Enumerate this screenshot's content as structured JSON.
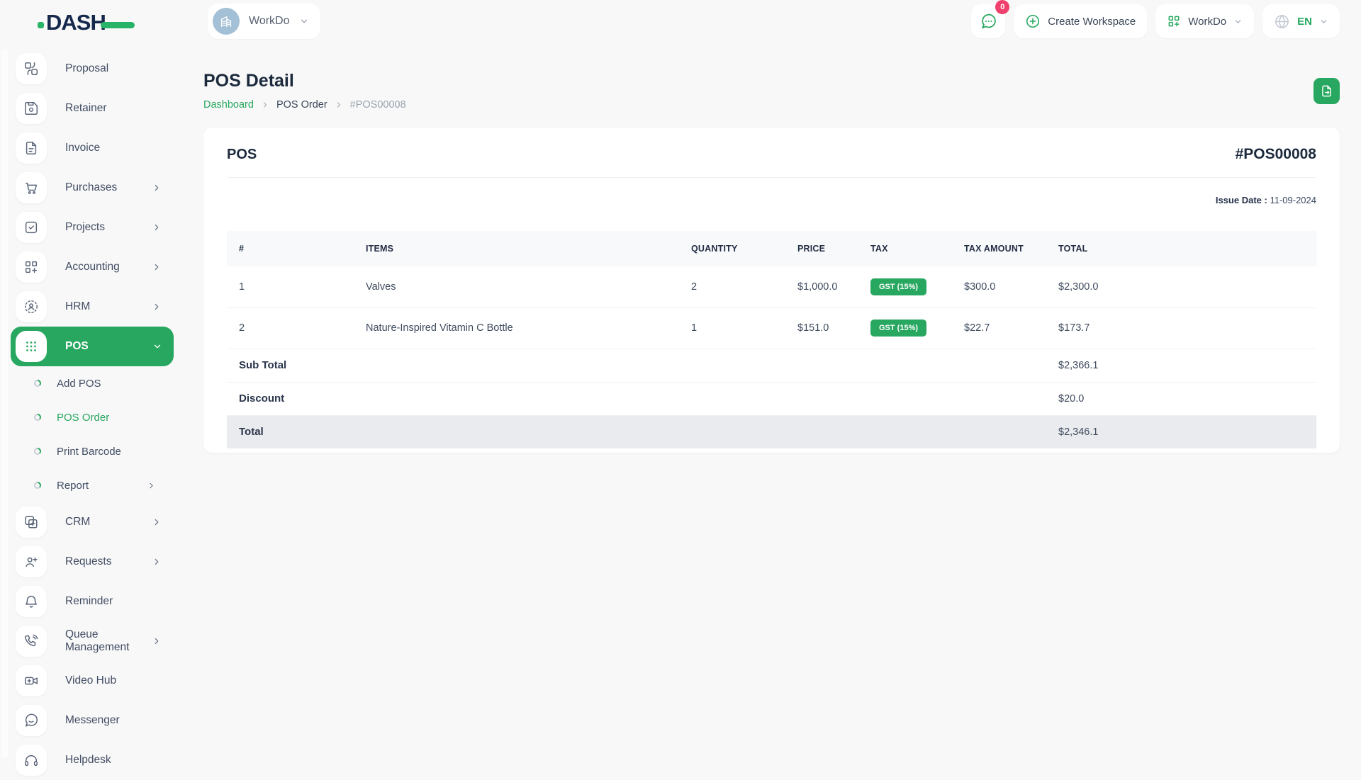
{
  "header": {
    "logo_text": "DASH",
    "workspace_selector": {
      "label": "WorkDo",
      "avatar_icon": "building-icon"
    },
    "messages": {
      "icon": "chat-icon",
      "badge_count": "0"
    },
    "create_workspace_label": "Create Workspace",
    "company_menu": {
      "label": "WorkDo",
      "icon": "grid-plus-icon"
    },
    "language": {
      "code": "EN",
      "icon": "globe-icon"
    }
  },
  "sidebar": {
    "items_top": [
      {
        "label": "Proposal",
        "icon": "proposal-icon",
        "has_submenu": false
      },
      {
        "label": "Retainer",
        "icon": "retainer-icon",
        "has_submenu": false
      },
      {
        "label": "Invoice",
        "icon": "invoice-icon",
        "has_submenu": false
      },
      {
        "label": "Purchases",
        "icon": "cart-icon",
        "has_submenu": true
      },
      {
        "label": "Projects",
        "icon": "check-square-icon",
        "has_submenu": true
      },
      {
        "label": "Accounting",
        "icon": "grid-plus-icon",
        "has_submenu": true
      },
      {
        "label": "HRM",
        "icon": "user-scan-icon",
        "has_submenu": true
      }
    ],
    "pos": {
      "label": "POS",
      "icon": "grid-dots-icon",
      "active": true,
      "expanded": true
    },
    "pos_submenu": [
      {
        "label": "Add POS",
        "active": false
      },
      {
        "label": "POS Order",
        "active": true
      },
      {
        "label": "Print Barcode",
        "active": false
      },
      {
        "label": "Report",
        "active": false,
        "has_submenu": true
      }
    ],
    "items_bottom": [
      {
        "label": "CRM",
        "icon": "copy-plus-icon",
        "has_submenu": true
      },
      {
        "label": "Requests",
        "icon": "user-plus-icon",
        "has_submenu": true
      },
      {
        "label": "Reminder",
        "icon": "bell-icon",
        "has_submenu": false
      },
      {
        "label": "Queue Management",
        "icon": "phone-icon",
        "has_submenu": true
      },
      {
        "label": "Video Hub",
        "icon": "video-icon",
        "has_submenu": false
      },
      {
        "label": "Messenger",
        "icon": "message-icon",
        "has_submenu": false
      },
      {
        "label": "Helpdesk",
        "icon": "headset-icon",
        "has_submenu": false
      }
    ]
  },
  "page": {
    "title": "POS Detail",
    "breadcrumb": {
      "home": "Dashboard",
      "section": "POS Order",
      "current": "#POS00008"
    },
    "export_button_icon": "file-export-icon"
  },
  "pos_card": {
    "title": "POS",
    "number": "#POS00008",
    "issue_date_label": "Issue Date :",
    "issue_date_value": "11-09-2024",
    "table": {
      "headers": {
        "no": "#",
        "items": "ITEMS",
        "quantity": "QUANTITY",
        "price": "PRICE",
        "tax": "TAX",
        "tax_amount": "TAX AMOUNT",
        "total": "TOTAL"
      },
      "rows": [
        {
          "no": "1",
          "item": "Valves",
          "qty": "2",
          "price": "$1,000.0",
          "tax": "GST (15%)",
          "tax_amount": "$300.0",
          "total": "$2,300.0"
        },
        {
          "no": "2",
          "item": "Nature-Inspired Vitamin C Bottle",
          "qty": "1",
          "price": "$151.0",
          "tax": "GST (15%)",
          "tax_amount": "$22.7",
          "total": "$173.7"
        }
      ],
      "summary": [
        {
          "label": "Sub Total",
          "value": "$2,366.1"
        },
        {
          "label": "Discount",
          "value": "$20.0"
        },
        {
          "label": "Total",
          "value": "$2,346.1"
        }
      ]
    }
  },
  "colors": {
    "accent_green": "#27a75f",
    "badge_pink": "#f0416c",
    "logo_navy": "#16294c",
    "page_bg": "#f8f8f8",
    "total_row_bg": "#e9ebee"
  }
}
